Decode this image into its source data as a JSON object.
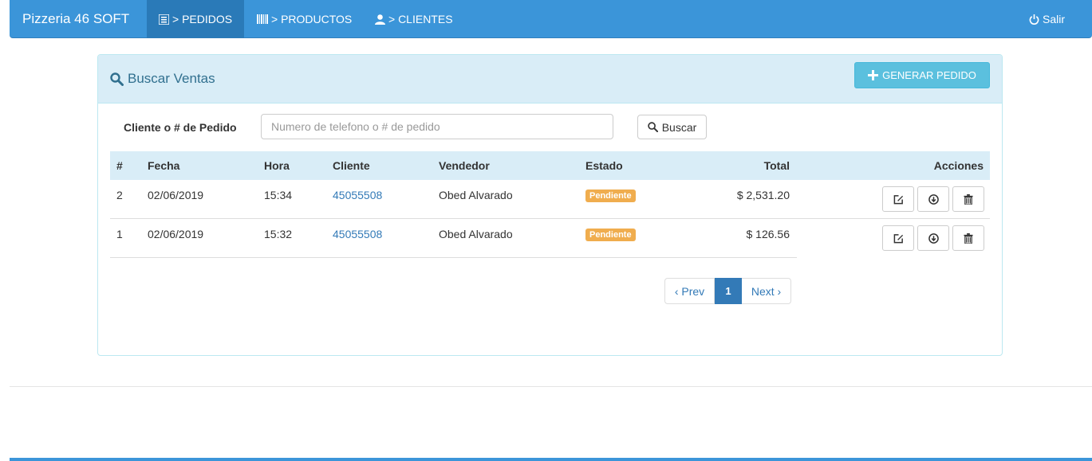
{
  "navbar": {
    "brand": "Pizzeria 46 SOFT",
    "items": [
      {
        "label": "> PEDIDOS",
        "icon": "list-icon",
        "active": true
      },
      {
        "label": "> PRODUCTOS",
        "icon": "barcode-icon",
        "active": false
      },
      {
        "label": "> CLIENTES",
        "icon": "user-icon",
        "active": false
      }
    ],
    "logout_label": "Salir"
  },
  "panel": {
    "title": "Buscar Ventas",
    "generate_button": "GENERAR PEDIDO"
  },
  "search": {
    "label": "Cliente o # de Pedido",
    "placeholder": "Numero de telefono o # de pedido",
    "value": "",
    "button": "Buscar"
  },
  "table": {
    "headers": {
      "num": "#",
      "fecha": "Fecha",
      "hora": "Hora",
      "cliente": "Cliente",
      "vendedor": "Vendedor",
      "estado": "Estado",
      "total": "Total",
      "acciones": "Acciones"
    },
    "rows": [
      {
        "num": "2",
        "fecha": "02/06/2019",
        "hora": "15:34",
        "cliente": "45055508",
        "vendedor": "Obed Alvarado",
        "estado": "Pendiente",
        "total": "$ 2,531.20"
      },
      {
        "num": "1",
        "fecha": "02/06/2019",
        "hora": "15:32",
        "cliente": "45055508",
        "vendedor": "Obed Alvarado",
        "estado": "Pendiente",
        "total": "$ 126.56"
      }
    ]
  },
  "pagination": {
    "prev": "‹ Prev",
    "current": "1",
    "next": "Next ›"
  },
  "colors": {
    "navbar": "#3b95d9",
    "panel_heading": "#d9edf7",
    "info_button": "#5bc0de",
    "warning_badge": "#f0ad4e",
    "link": "#337ab7"
  }
}
